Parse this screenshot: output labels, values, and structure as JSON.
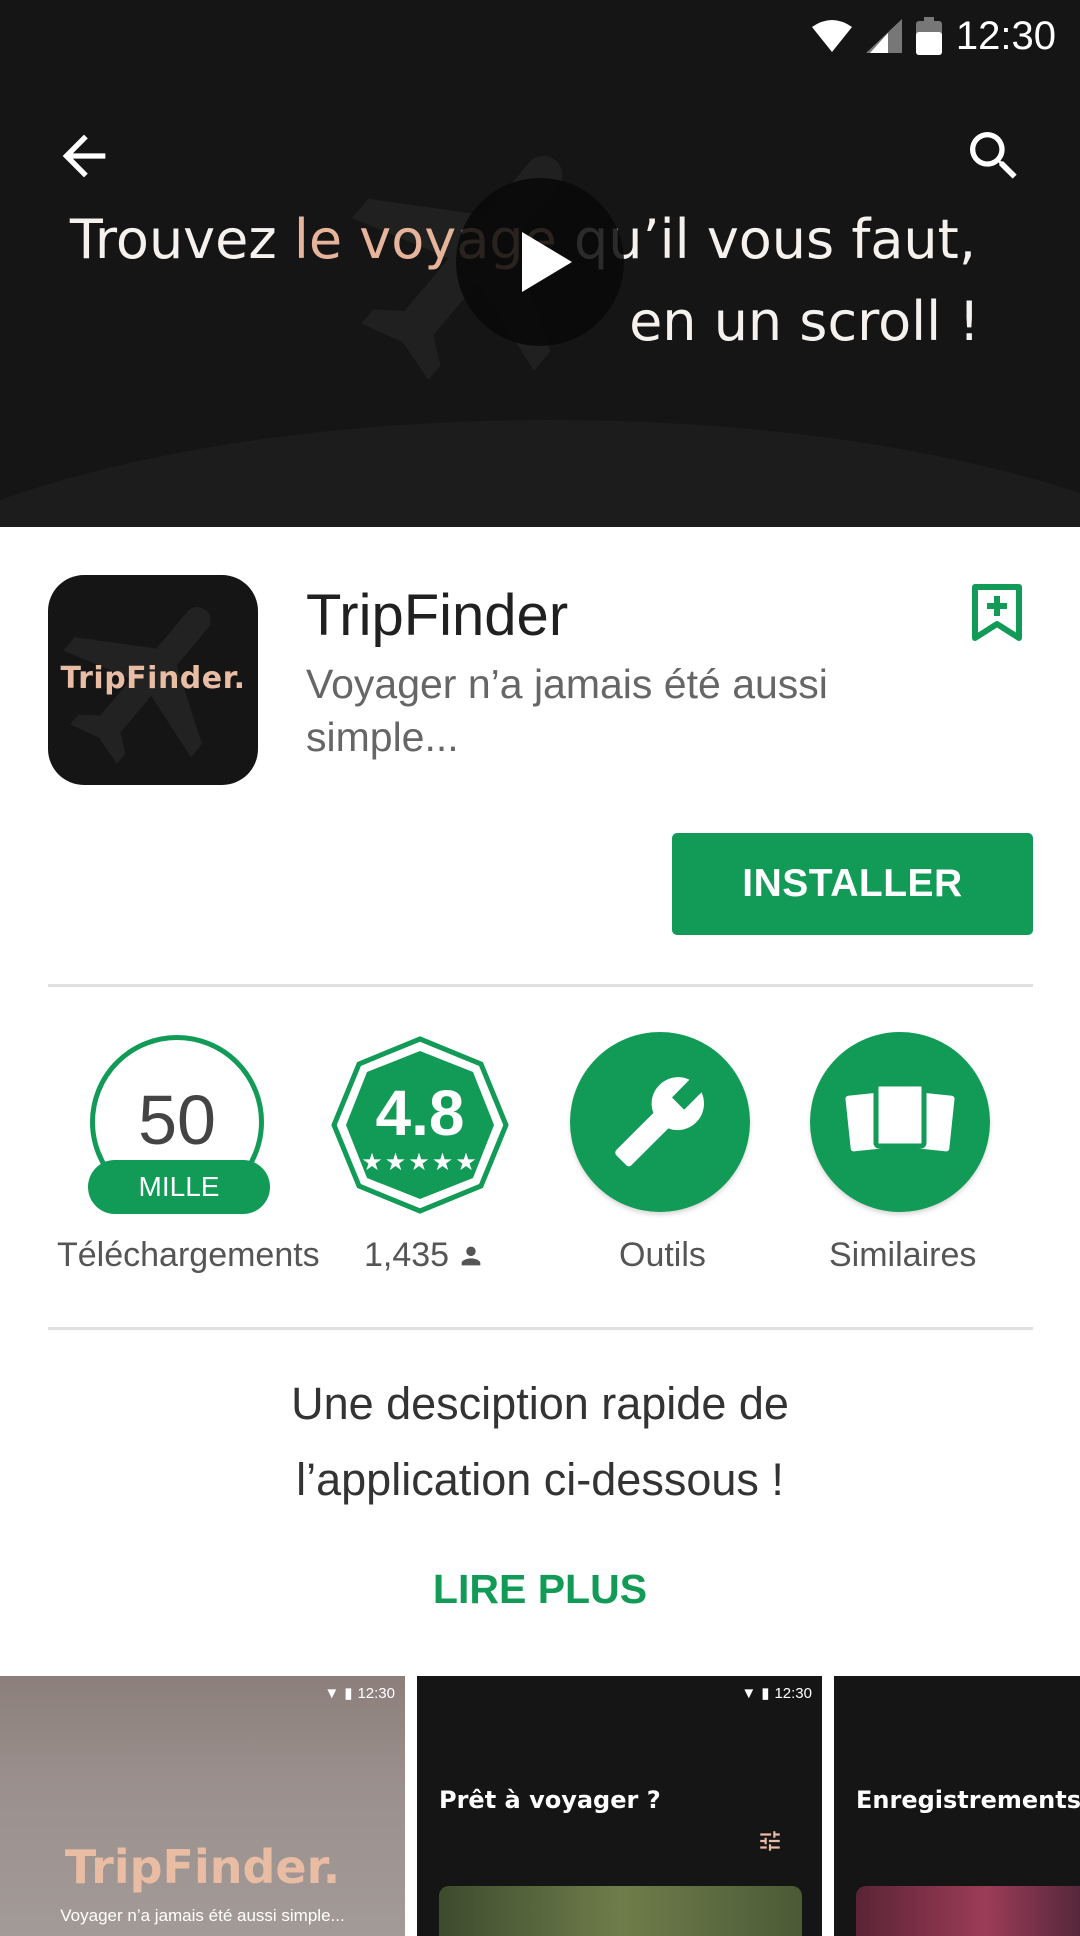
{
  "status_bar": {
    "time": "12:30"
  },
  "hero": {
    "line1_pre": "Trouvez ",
    "line1_highlight": "le voyage",
    "line1_post": " qu’il vous faut,",
    "line2": "en un scroll !"
  },
  "app": {
    "icon_text": "TripFinder.",
    "name": "TripFinder",
    "tagline": "Voyager n’a jamais été aussi simple...",
    "install_label": "INSTALLER"
  },
  "stats": {
    "downloads_value": "50",
    "downloads_unit": "MILLE",
    "downloads_label": "Téléchargements",
    "rating_value": "4.8",
    "rating_stars": "★★★★★",
    "rating_count": "1,435",
    "tools_label": "Outils",
    "similar_label": "Similaires"
  },
  "description": {
    "line1": "Une desciption rapide de",
    "line2": "l’application ci-dessous !",
    "read_more": "LIRE PLUS"
  },
  "screenshots": [
    {
      "time": "12:30",
      "title": "TripFinder.",
      "subtitle": "Voyager n’a jamais été aussi simple..."
    },
    {
      "time": "12:30",
      "heading": "Prêt à voyager ?"
    },
    {
      "heading": "Enregistrements"
    }
  ],
  "colors": {
    "accent": "#129a57",
    "hero_bg": "#151515",
    "brand_peach": "#e9bca4"
  },
  "icons": [
    "wifi-icon",
    "signal-icon",
    "battery-icon",
    "back-arrow-icon",
    "search-icon",
    "play-icon",
    "bookmark-add-icon",
    "person-icon",
    "wrench-icon",
    "cards-icon",
    "filter-icon"
  ]
}
